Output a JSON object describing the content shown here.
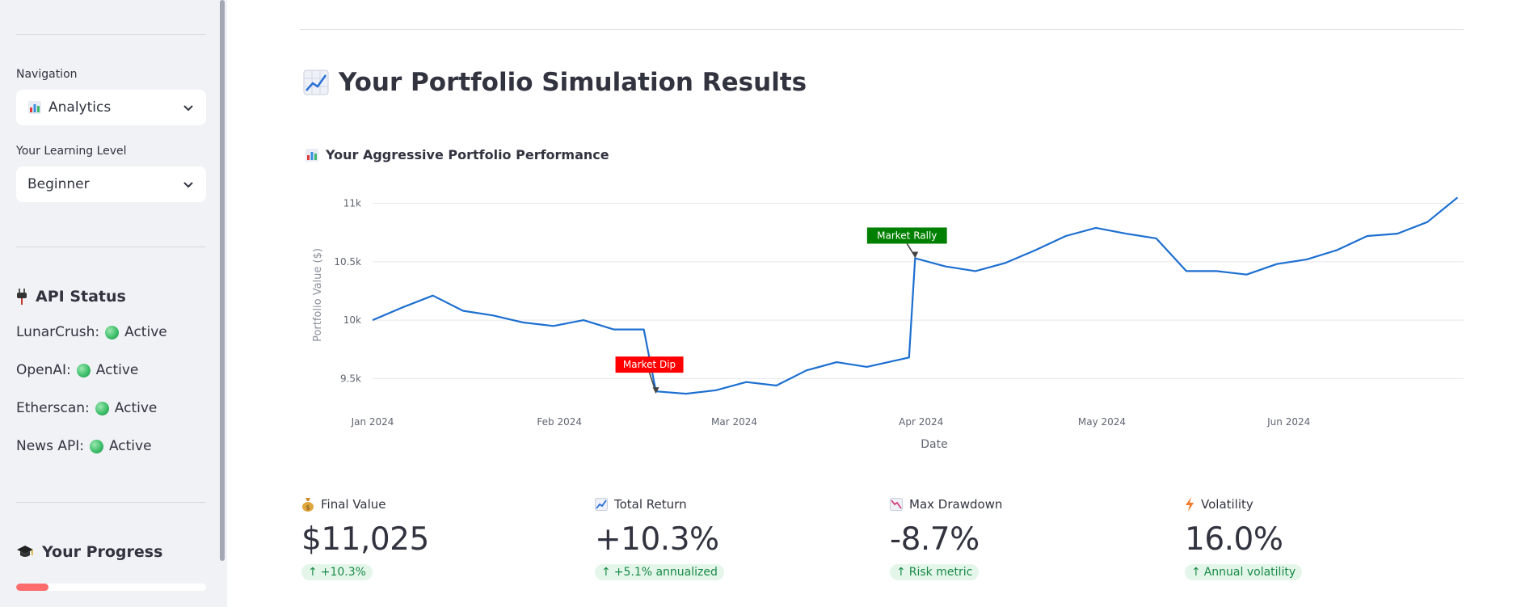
{
  "sidebar": {
    "nav_label": "Navigation",
    "nav_value": "Analytics",
    "level_label": "Your Learning Level",
    "level_value": "Beginner",
    "api_heading": "API Status",
    "apis": [
      {
        "name": "LunarCrush:",
        "status": "Active"
      },
      {
        "name": "OpenAI:",
        "status": "Active"
      },
      {
        "name": "Etherscan:",
        "status": "Active"
      },
      {
        "name": "News API:",
        "status": "Active"
      }
    ],
    "progress_heading": "Your Progress",
    "progress_fraction": 0.17
  },
  "main": {
    "page_title": "Your Portfolio Simulation Results",
    "chart_title": "Your Aggressive Portfolio Performance"
  },
  "chart_data": {
    "type": "line",
    "xlabel": "Date",
    "ylabel": "Portfolio Value ($)",
    "ylim": [
      9350,
      11080
    ],
    "x_ticks": [
      "Jan 2024",
      "Feb 2024",
      "Mar 2024",
      "Apr 2024",
      "May 2024",
      "Jun 2024"
    ],
    "y_ticks": [
      {
        "value": 9500,
        "label": "9.5k"
      },
      {
        "value": 10000,
        "label": "10k"
      },
      {
        "value": 10500,
        "label": "10.5k"
      },
      {
        "value": 11000,
        "label": "11k"
      }
    ],
    "line_color": "#1c6fd0",
    "series": [
      {
        "x": [
          "2024-01-01",
          "2024-01-06",
          "2024-01-11",
          "2024-01-16",
          "2024-01-21",
          "2024-01-26",
          "2024-01-31",
          "2024-02-05",
          "2024-02-10",
          "2024-02-15",
          "2024-02-17",
          "2024-02-22",
          "2024-02-27",
          "2024-03-03",
          "2024-03-08",
          "2024-03-13",
          "2024-03-18",
          "2024-03-23",
          "2024-03-30",
          "2024-03-31",
          "2024-04-05",
          "2024-04-10",
          "2024-04-15",
          "2024-04-20",
          "2024-04-25",
          "2024-04-30",
          "2024-05-05",
          "2024-05-10",
          "2024-05-15",
          "2024-05-20",
          "2024-05-25",
          "2024-05-30",
          "2024-06-04",
          "2024-06-09",
          "2024-06-14",
          "2024-06-19",
          "2024-06-24",
          "2024-06-29"
        ],
        "y": [
          10000,
          10110,
          10210,
          10080,
          10040,
          9980,
          9950,
          10000,
          9920,
          9920,
          9390,
          9370,
          9400,
          9470,
          9440,
          9570,
          9640,
          9600,
          9680,
          10530,
          10460,
          10420,
          10490,
          10600,
          10720,
          10790,
          10740,
          10700,
          10420,
          10420,
          10390,
          10480,
          10520,
          10600,
          10720,
          10740,
          10840,
          11050
        ]
      }
    ],
    "annotations": [
      {
        "text": "Market Dip",
        "x": "2024-02-17",
        "y": 9370,
        "color": "#ff0000"
      },
      {
        "text": "Market Rally",
        "x": "2024-03-31",
        "y": 10530,
        "color": "#008000"
      }
    ]
  },
  "metrics": [
    {
      "label": "Final Value",
      "value": "$11,025",
      "delta": "+10.3%",
      "icon": "money-bag-icon"
    },
    {
      "label": "Total Return",
      "value": "+10.3%",
      "delta": "+5.1% annualized",
      "icon": "chart-up-icon"
    },
    {
      "label": "Max Drawdown",
      "value": "-8.7%",
      "delta": "Risk metric",
      "icon": "chart-down-icon"
    },
    {
      "label": "Volatility",
      "value": "16.0%",
      "delta": "Annual volatility",
      "icon": "lightning-icon"
    }
  ]
}
